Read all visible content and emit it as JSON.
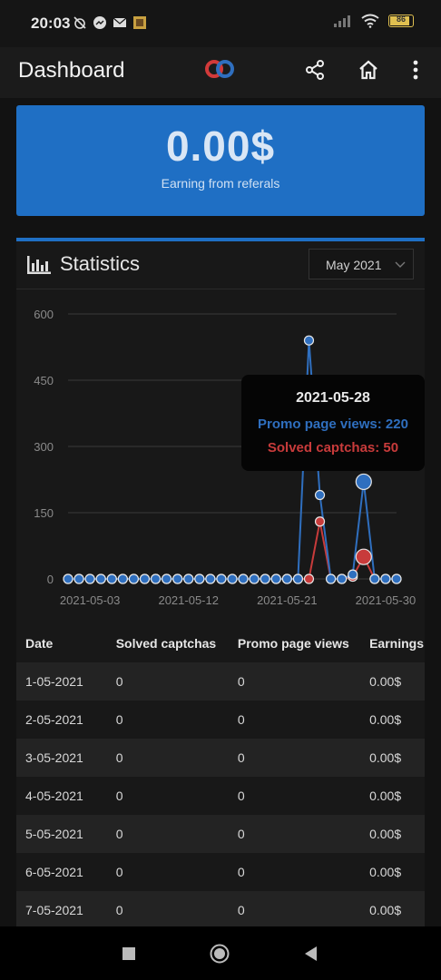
{
  "status": {
    "time": "20:03",
    "battery": "86"
  },
  "appbar": {
    "title": "Dashboard",
    "icons": [
      "logo",
      "share-icon",
      "home-icon",
      "more-vert-icon"
    ]
  },
  "earnings": {
    "value": "0.00$",
    "label": "Earning from referals"
  },
  "stats": {
    "title": "Statistics",
    "month": "May 2021"
  },
  "chart_data": {
    "type": "line",
    "ylim": [
      0,
      600
    ],
    "yticks": [
      "0",
      "150",
      "300",
      "450",
      "600"
    ],
    "xtick_labels": [
      "2021-05-03",
      "2021-05-12",
      "2021-05-21",
      "2021-05-30"
    ],
    "x": [
      "2021-05-01",
      "2021-05-02",
      "2021-05-03",
      "2021-05-04",
      "2021-05-05",
      "2021-05-06",
      "2021-05-07",
      "2021-05-08",
      "2021-05-09",
      "2021-05-10",
      "2021-05-11",
      "2021-05-12",
      "2021-05-13",
      "2021-05-14",
      "2021-05-15",
      "2021-05-16",
      "2021-05-17",
      "2021-05-18",
      "2021-05-19",
      "2021-05-20",
      "2021-05-21",
      "2021-05-22",
      "2021-05-23",
      "2021-05-24",
      "2021-05-25",
      "2021-05-26",
      "2021-05-27",
      "2021-05-28",
      "2021-05-29",
      "2021-05-30",
      "2021-05-31"
    ],
    "series": [
      {
        "name": "Promo page views",
        "color": "#2f6fbf",
        "values": [
          0,
          0,
          0,
          0,
          0,
          0,
          0,
          0,
          0,
          0,
          0,
          0,
          0,
          0,
          0,
          0,
          0,
          0,
          0,
          0,
          0,
          0,
          540,
          190,
          0,
          0,
          10,
          220,
          0,
          0,
          0
        ]
      },
      {
        "name": "Solved captchas",
        "color": "#c83b3b",
        "values": [
          0,
          0,
          0,
          0,
          0,
          0,
          0,
          0,
          0,
          0,
          0,
          0,
          0,
          0,
          0,
          0,
          0,
          0,
          0,
          0,
          0,
          0,
          0,
          130,
          0,
          0,
          5,
          50,
          0,
          0,
          0
        ]
      }
    ],
    "highlight_index": 27,
    "tooltip": {
      "date": "2021-05-28",
      "line1": "Promo page views: 220",
      "line2": "Solved captchas: 50"
    },
    "grid": true
  },
  "table": {
    "headers": [
      "Date",
      "Solved captchas",
      "Promo page views",
      "Earnings"
    ],
    "rows": [
      [
        "1-05-2021",
        "0",
        "0",
        "0.00$"
      ],
      [
        "2-05-2021",
        "0",
        "0",
        "0.00$"
      ],
      [
        "3-05-2021",
        "0",
        "0",
        "0.00$"
      ],
      [
        "4-05-2021",
        "0",
        "0",
        "0.00$"
      ],
      [
        "5-05-2021",
        "0",
        "0",
        "0.00$"
      ],
      [
        "6-05-2021",
        "0",
        "0",
        "0.00$"
      ],
      [
        "7-05-2021",
        "0",
        "0",
        "0.00$"
      ]
    ]
  }
}
